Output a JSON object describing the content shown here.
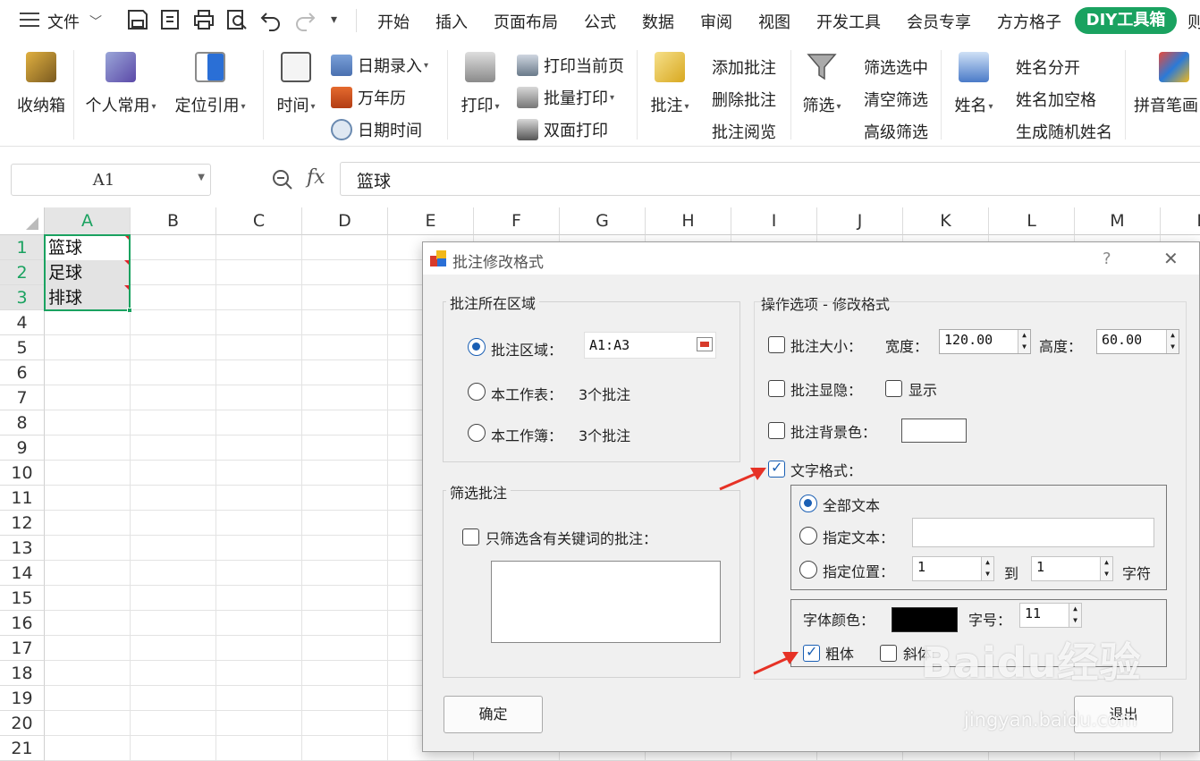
{
  "menubar": {
    "file_label": "文件",
    "tabs": [
      "开始",
      "插入",
      "页面布局",
      "公式",
      "数据",
      "审阅",
      "视图",
      "开发工具",
      "会员专享",
      "方方格子",
      "DIY工具箱",
      "则"
    ]
  },
  "ribbon": {
    "collect": "收纳箱",
    "personal": "个人常用",
    "locate": "定位引用",
    "time": "时间",
    "date_entry": "日期录入",
    "calendar": "万年历",
    "datetime": "日期时间",
    "print": "打印",
    "print_current": "打印当前页",
    "batch_print": "批量打印",
    "duplex_print": "双面打印",
    "comment": "批注",
    "add_comment": "添加批注",
    "delete_comment": "删除批注",
    "browse_comment": "批注阅览",
    "filter": "筛选",
    "filter_selected": "筛选选中",
    "clear_filter": "清空筛选",
    "advanced_filter": "高级筛选",
    "name": "姓名",
    "name_split": "姓名分开",
    "name_space": "姓名加空格",
    "random_name": "生成随机姓名",
    "pinyin": "拼音笔画"
  },
  "formula_bar": {
    "cell_ref": "A1",
    "fx": "fx",
    "content": "篮球"
  },
  "grid": {
    "columns": [
      "A",
      "B",
      "C",
      "D",
      "E",
      "F",
      "G",
      "H",
      "I",
      "J",
      "K",
      "L",
      "M",
      "N"
    ],
    "rows": [
      "1",
      "2",
      "3",
      "4",
      "5",
      "6",
      "7",
      "8",
      "9",
      "10",
      "11",
      "12",
      "13",
      "14",
      "15",
      "16",
      "17",
      "18",
      "19",
      "20",
      "21"
    ],
    "cells": [
      "篮球",
      "足球",
      "排球"
    ]
  },
  "dialog": {
    "title": "批注修改格式",
    "help": "?",
    "close": "✕",
    "area_group": "批注所在区域",
    "area_radio": "批注区域：",
    "area_value": "A1:A3",
    "sheet_radio": "本工作表：",
    "sheet_count": "3个批注",
    "book_radio": "本工作簿：",
    "book_count": "3个批注",
    "filter_group": "筛选批注",
    "filter_check": "只筛选含有关键词的批注：",
    "options_title": "操作选项 - 修改格式",
    "size_check": "批注大小：",
    "width_label": "宽度：",
    "width_value": "120.00",
    "height_label": "高度：",
    "height_value": "60.00",
    "show_check": "批注显隐：",
    "show_label": "显示",
    "bg_check": "批注背景色：",
    "text_format_check": "文字格式：",
    "all_text": "全部文本",
    "spec_text": "指定文本：",
    "spec_pos": "指定位置：",
    "pos_from": "1",
    "pos_to_label": "到",
    "pos_to": "1",
    "char_label": "字符",
    "font_color_label": "字体颜色：",
    "font_size_label": "字号：",
    "font_size_value": "11",
    "bold_label": "粗体",
    "italic_label": "斜体",
    "ok_button": "确定",
    "exit_button": "退出"
  },
  "colors": {
    "accent_green": "#1aa260",
    "selected_blue": "#1a5fb4",
    "arrow_red": "#e63226",
    "font_color_swatch": "#000000",
    "bg_color_swatch": "#ffffff"
  },
  "watermark": {
    "brand": "Baidu经验",
    "url": "jingyan.baidu.com"
  }
}
